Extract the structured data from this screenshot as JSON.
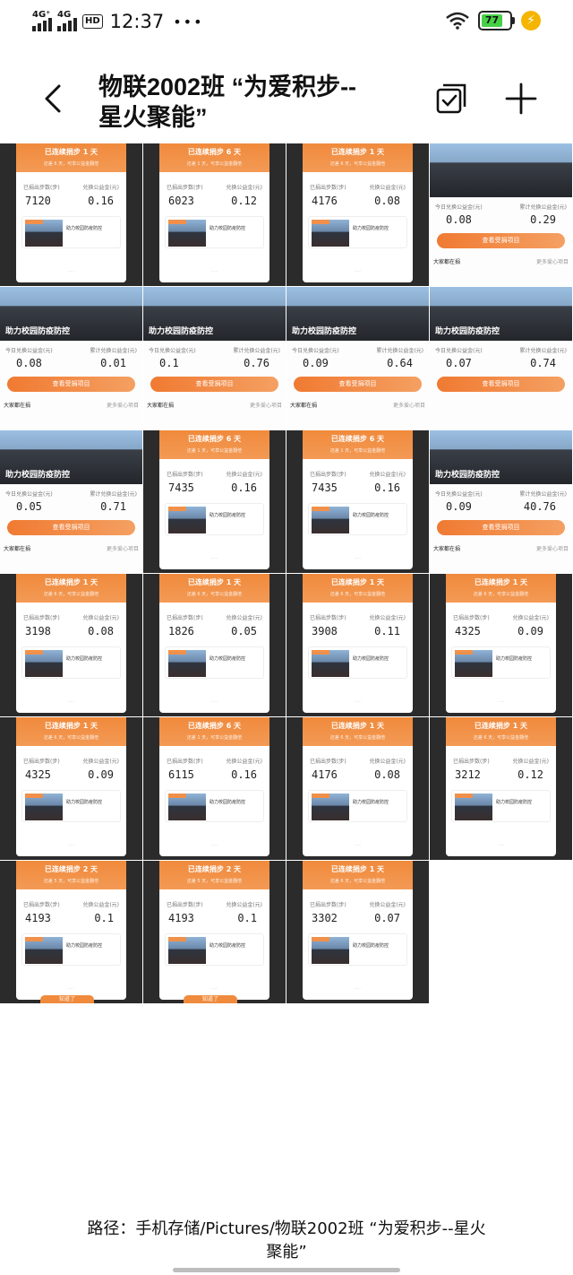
{
  "status_bar": {
    "net1": "4G⁺",
    "net2": "4G",
    "hd": "HD",
    "time": "12:37",
    "extra": "•••",
    "battery": "77"
  },
  "header": {
    "title": "物联2002班 “为爱积步--星火聚能”"
  },
  "thumbnails": [
    {
      "kind": "steps",
      "banner": "已连续捐步 1 天",
      "sub": "还差 6 天，可享公益金翻倍",
      "l1": "已捐出步数(步)",
      "l2": "兑换公益金(元)",
      "v1": "7120",
      "v2": "0.16",
      "mini": "助力校园防疫防控"
    },
    {
      "kind": "steps",
      "banner": "已连续捐步 6 天",
      "sub": "还差 1 天，可享公益金翻倍",
      "l1": "已捐出步数(步)",
      "l2": "兑换公益金(元)",
      "v1": "6023",
      "v2": "0.12",
      "mini": "助力校园防疫防控"
    },
    {
      "kind": "steps",
      "banner": "已连续捐步 1 天",
      "sub": "还差 6 天，可享公益金翻倍",
      "l1": "已捐出步数(步)",
      "l2": "兑换公益金(元)",
      "v1": "4176",
      "v2": "0.08",
      "mini": "助力校园防疫防控"
    },
    {
      "kind": "photo",
      "caption": "",
      "l1": "今日兑换公益金(元)",
      "l2": "累计兑换公益金(元)",
      "v1": "0.08",
      "v2": "0.29",
      "btn": "查看受捐项目",
      "f1": "大家都在捐",
      "f2": "更多爱心项目"
    },
    {
      "kind": "photo",
      "caption": "助力校园防疫防控",
      "l1": "今日兑换公益金(元)",
      "l2": "累计兑换公益金(元)",
      "v1": "0.08",
      "v2": "0.01",
      "btn": "查看受捐项目",
      "f1": "大家都在捐",
      "f2": "更多爱心项目"
    },
    {
      "kind": "photo",
      "caption": "助力校园防疫防控",
      "l1": "今日兑换公益金(元)",
      "l2": "累计兑换公益金(元)",
      "v1": "0.1",
      "v2": "0.76",
      "btn": "查看受捐项目",
      "f1": "大家都在捐",
      "f2": "更多爱心项目"
    },
    {
      "kind": "photo",
      "caption": "助力校园防疫防控",
      "l1": "今日兑换公益金(元)",
      "l2": "累计兑换公益金(元)",
      "v1": "0.09",
      "v2": "0.64",
      "btn": "查看受捐项目",
      "f1": "大家都在捐",
      "f2": "更多爱心项目"
    },
    {
      "kind": "photo",
      "caption": "助力校园防疫防控",
      "l1": "今日兑换公益金(元)",
      "l2": "累计兑换公益金(元)",
      "v1": "0.07",
      "v2": "0.74",
      "btn": "查看受捐项目",
      "f1": "",
      "f2": ""
    },
    {
      "kind": "photo",
      "caption": "助力校园防疫防控",
      "l1": "今日兑换公益金(元)",
      "l2": "累计兑换公益金(元)",
      "v1": "0.05",
      "v2": "0.71",
      "btn": "查看受捐项目",
      "f1": "大家都在捐",
      "f2": "更多爱心项目"
    },
    {
      "kind": "steps",
      "banner": "已连续捐步 6 天",
      "sub": "还差 1 天，可享公益金翻倍",
      "l1": "已捐出步数(步)",
      "l2": "兑换公益金(元)",
      "v1": "7435",
      "v2": "0.16",
      "mini": "助力校园防疫防控"
    },
    {
      "kind": "steps",
      "banner": "已连续捐步 6 天",
      "sub": "还差 1 天，可享公益金翻倍",
      "l1": "已捐出步数(步)",
      "l2": "兑换公益金(元)",
      "v1": "7435",
      "v2": "0.16",
      "mini": "助力校园防疫防控"
    },
    {
      "kind": "photo",
      "caption": "助力校园防疫防控",
      "l1": "今日兑换公益金(元)",
      "l2": "累计兑换公益金(元)",
      "v1": "0.09",
      "v2": "40.76",
      "btn": "查看受捐项目",
      "f1": "大家都在捐",
      "f2": "更多爱心项目"
    },
    {
      "kind": "steps",
      "banner": "已连续捐步 1 天",
      "sub": "还差 6 天，可享公益金翻倍",
      "l1": "已捐出步数(步)",
      "l2": "兑换公益金(元)",
      "v1": "3198",
      "v2": "0.08",
      "mini": "助力校园防疫防控"
    },
    {
      "kind": "steps",
      "banner": "已连续捐步 1 天",
      "sub": "还差 6 天，可享公益金翻倍",
      "l1": "已捐出步数(步)",
      "l2": "兑换公益金(元)",
      "v1": "1826",
      "v2": "0.05",
      "mini": "助力校园防疫防控"
    },
    {
      "kind": "steps",
      "banner": "已连续捐步 1 天",
      "sub": "还差 6 天，可享公益金翻倍",
      "l1": "已捐出步数(步)",
      "l2": "兑换公益金(元)",
      "v1": "3908",
      "v2": "0.11",
      "mini": "助力校园防疫防控"
    },
    {
      "kind": "steps",
      "banner": "已连续捐步 1 天",
      "sub": "还差 6 天，可享公益金翻倍",
      "l1": "已捐出步数(步)",
      "l2": "兑换公益金(元)",
      "v1": "4325",
      "v2": "0.09",
      "mini": "助力校园防疫防控"
    },
    {
      "kind": "steps",
      "banner": "已连续捐步 1 天",
      "sub": "还差 6 天，可享公益金翻倍",
      "l1": "已捐出步数(步)",
      "l2": "兑换公益金(元)",
      "v1": "4325",
      "v2": "0.09",
      "mini": "助力校园防疫防控"
    },
    {
      "kind": "steps",
      "banner": "已连续捐步 6 天",
      "sub": "还差 1 天，可享公益金翻倍",
      "l1": "已捐出步数(步)",
      "l2": "兑换公益金(元)",
      "v1": "6115",
      "v2": "0.16",
      "mini": "助力校园防疫防控"
    },
    {
      "kind": "steps",
      "banner": "已连续捐步 1 天",
      "sub": "还差 6 天，可享公益金翻倍",
      "l1": "已捐出步数(步)",
      "l2": "兑换公益金(元)",
      "v1": "4176",
      "v2": "0.08",
      "mini": "助力校园防疫防控"
    },
    {
      "kind": "steps",
      "banner": "已连续捐步 1 天",
      "sub": "还差 6 天，可享公益金翻倍",
      "l1": "已捐出步数(步)",
      "l2": "兑换公益金(元)",
      "v1": "3212",
      "v2": "0.12",
      "mini": "助力校园防疫防控"
    },
    {
      "kind": "steps",
      "banner": "已连续捐步 2 天",
      "sub": "还差 5 天，可享公益金翻倍",
      "l1": "已捐出步数(步)",
      "l2": "兑换公益金(元)",
      "v1": "4193",
      "v2": "0.1",
      "mini": "助力校园防疫防控",
      "ack": "知道了"
    },
    {
      "kind": "steps",
      "banner": "已连续捐步 2 天",
      "sub": "还差 5 天，可享公益金翻倍",
      "l1": "已捐出步数(步)",
      "l2": "兑换公益金(元)",
      "v1": "4193",
      "v2": "0.1",
      "mini": "助力校园防疫防控",
      "ack": "知道了"
    },
    {
      "kind": "steps",
      "banner": "已连续捐步 1 天",
      "sub": "还差 6 天，可享公益金翻倍",
      "l1": "已捐出步数(步)",
      "l2": "兑换公益金(元)",
      "v1": "3302",
      "v2": "0.07",
      "mini": "助力校园防疫防控"
    }
  ],
  "path": {
    "text": "路径：手机存储/Pictures/物联2002班 “为爱积步--星火聚能”"
  }
}
